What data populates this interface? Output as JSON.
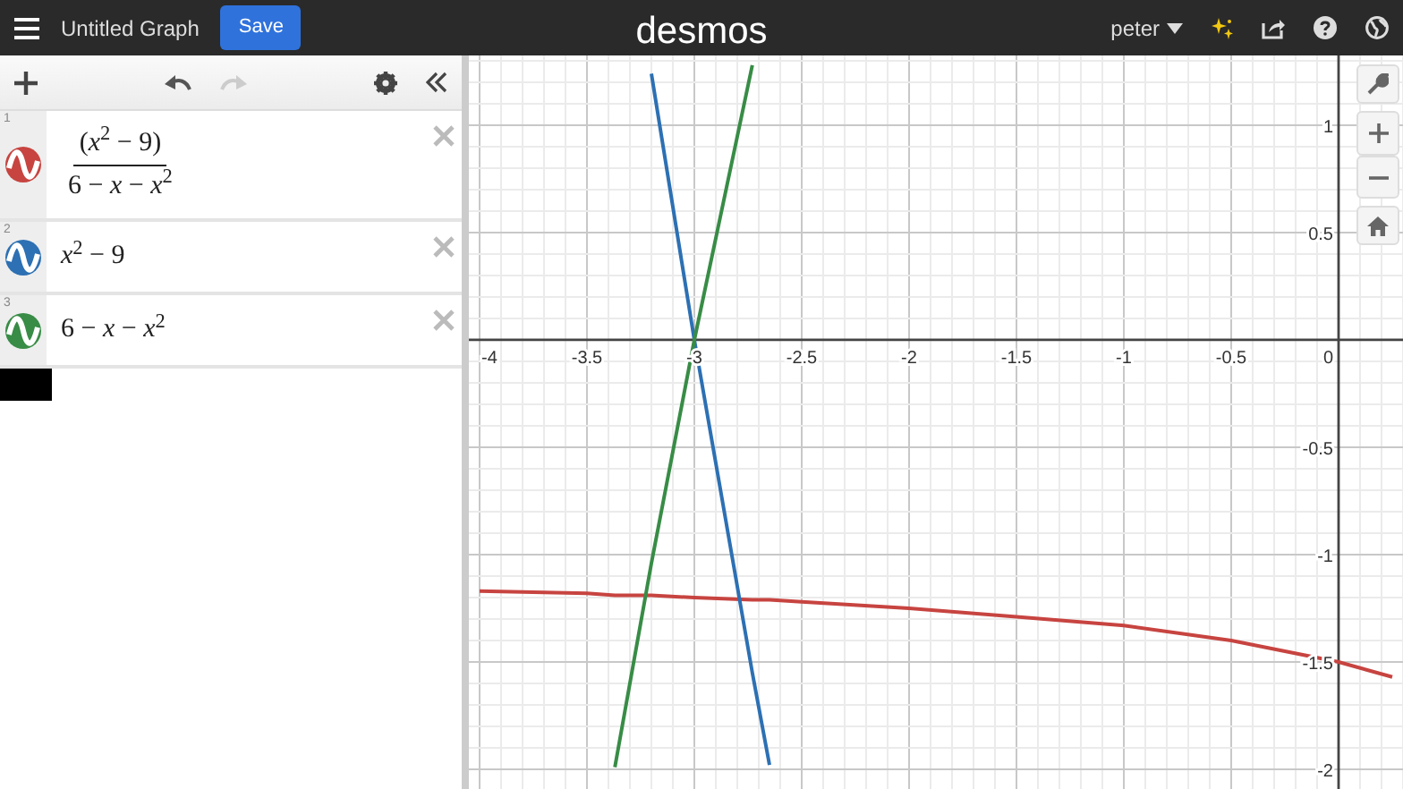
{
  "header": {
    "title": "Untitled Graph",
    "save_label": "Save",
    "logo": "desmos",
    "user": "peter"
  },
  "expressions": [
    {
      "index": "1",
      "kind": "fraction",
      "color": "#c74440",
      "numerator": "(*x*$^{2}$ − 9)",
      "denominator": "6 − *x* − *x*$^{2}$"
    },
    {
      "index": "2",
      "kind": "plain",
      "color": "#2d70b3",
      "text": "*x*$^{2}$ − 9"
    },
    {
      "index": "3",
      "kind": "plain",
      "color": "#388c46",
      "text": "6 − *x* − *x*$^{2}$"
    }
  ],
  "graph": {
    "chart_data": {
      "type": "line",
      "x": [
        -4,
        -3.5,
        -3.37,
        -3.2,
        -3,
        -2.73,
        -2.65,
        -2.5,
        -2,
        -1.5,
        -1,
        -0.5,
        0,
        0.25
      ],
      "series": [
        {
          "color": "#c74440",
          "values": [
            -1.17,
            -1.18,
            -1.19,
            -1.19,
            -1.2,
            -1.21,
            -1.21,
            -1.22,
            -1.25,
            -1.29,
            -1.33,
            -1.4,
            -1.5,
            -1.57
          ]
        },
        {
          "color": "#2d70b3",
          "values": [
            null,
            null,
            null,
            1.24,
            0,
            -1.55,
            -1.98,
            null,
            null,
            null,
            null,
            null,
            null,
            null
          ]
        },
        {
          "color": "#388c46",
          "values": [
            null,
            null,
            -1.99,
            -1.04,
            0,
            1.28,
            null,
            null,
            null,
            null,
            null,
            null,
            null,
            null
          ]
        }
      ],
      "grid": true,
      "xlim": [
        -4.05,
        0.3
      ],
      "ylim": [
        -2.092,
        1.325
      ],
      "xticks": [
        {
          "value": -4,
          "label": "-4"
        },
        {
          "value": -3.5,
          "label": "-3.5"
        },
        {
          "value": -3,
          "label": "-3"
        },
        {
          "value": -2.5,
          "label": "-2.5"
        },
        {
          "value": -2,
          "label": "-2"
        },
        {
          "value": -1.5,
          "label": "-1.5"
        },
        {
          "value": -1,
          "label": "-1"
        },
        {
          "value": -0.5,
          "label": "-0.5"
        },
        {
          "value": 0,
          "label": "0"
        }
      ],
      "yticks": [
        {
          "value": 1,
          "label": "1"
        },
        {
          "value": 0.5,
          "label": "0.5"
        },
        {
          "value": -0.5,
          "label": "-0.5"
        },
        {
          "value": -1,
          "label": "-1"
        },
        {
          "value": -1.5,
          "label": "-1.5"
        },
        {
          "value": -2,
          "label": "-2"
        }
      ]
    }
  }
}
